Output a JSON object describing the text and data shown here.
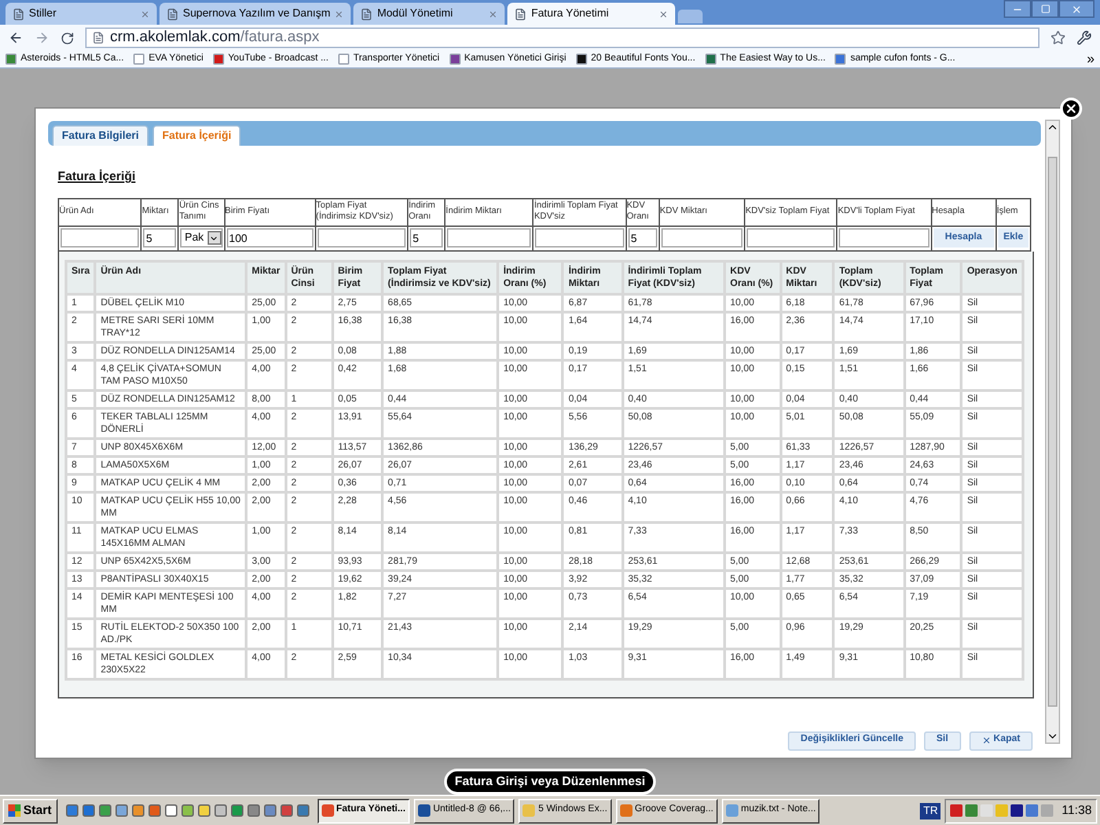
{
  "browser": {
    "tabs": [
      {
        "title": "Stiller",
        "selected": false
      },
      {
        "title": "Supernova Yazılım ve Danışm",
        "selected": false
      },
      {
        "title": "Modül Yönetimi",
        "selected": false
      },
      {
        "title": "Fatura Yönetimi",
        "selected": true
      }
    ],
    "address": {
      "host": "crm.akolemlak.com",
      "path": "/fatura.aspx"
    },
    "bookmarks": [
      {
        "label": "Asteroids - HTML5 Ca...",
        "color": "#3a8a3a"
      },
      {
        "label": "EVA Yönetici",
        "color": "#ffffff"
      },
      {
        "label": "YouTube - Broadcast ...",
        "color": "#d11a1a"
      },
      {
        "label": "Transporter Yönetici",
        "color": "#ffffff"
      },
      {
        "label": "Kamusen Yönetici Girişi",
        "color": "#7a3f9a"
      },
      {
        "label": "20 Beautiful Fonts You...",
        "color": "#111111"
      },
      {
        "label": "The Easiest Way to Us...",
        "color": "#1f6f4a"
      },
      {
        "label": "sample cufon fonts - G...",
        "color": "#3b73d8"
      }
    ],
    "more": "»"
  },
  "modal": {
    "tabs": [
      {
        "label": "Fatura Bilgileri",
        "selected": false
      },
      {
        "label": "Fatura İçeriği",
        "selected": true
      }
    ],
    "section_title": "Fatura İçeriği",
    "entry_form": {
      "columns": [
        "Ürün Adı",
        "Miktarı",
        "Ürün Cins Tanımı",
        "Birim Fiyatı",
        "Toplam Fiyat (İndirimsiz KDV'siz)",
        "İndirim Oranı",
        "İndirim Miktarı",
        "İndirimli Toplam Fiyat KDV'siz",
        "KDV Oranı",
        "KDV Miktarı",
        "KDV'siz Toplam Fiyat",
        "KDV'li Toplam Fiyat",
        "Hesapla",
        "İşlem"
      ],
      "fields": [
        {
          "kind": "input"
        },
        {
          "kind": "input",
          "value": "5"
        },
        {
          "kind": "select",
          "value": "Pak"
        },
        {
          "kind": "input",
          "value": "100"
        },
        {
          "kind": "input"
        },
        {
          "kind": "input",
          "value": "5"
        },
        {
          "kind": "input"
        },
        {
          "kind": "input"
        },
        {
          "kind": "input",
          "value": "5"
        },
        {
          "kind": "input"
        },
        {
          "kind": "input"
        },
        {
          "kind": "input"
        },
        {
          "kind": "button",
          "label": "Hesapla"
        },
        {
          "kind": "button",
          "label": "Ekle"
        }
      ]
    },
    "items_table": {
      "columns": [
        "Sıra",
        "Ürün Adı",
        "Miktar",
        "Ürün Cinsi",
        "Birim Fiyat",
        "Toplam Fiyat (İndirimsiz ve KDV'siz)",
        "İndirim Oranı (%)",
        "İndirim Miktarı",
        "İndirimli Toplam Fiyat (KDV'siz)",
        "KDV Oranı (%)",
        "KDV Miktarı",
        "Toplam (KDV'siz)",
        "Toplam Fiyat",
        "Operasyon"
      ],
      "rows": [
        [
          "1",
          "DÜBEL ÇELİK M10",
          "25,00",
          "2",
          "2,75",
          "68,65",
          "10,00",
          "6,87",
          "61,78",
          "10,00",
          "6,18",
          "61,78",
          "67,96",
          "Sil"
        ],
        [
          "2",
          "METRE SARI SERİ 10MM TRAY*12",
          "1,00",
          "2",
          "16,38",
          "16,38",
          "10,00",
          "1,64",
          "14,74",
          "16,00",
          "2,36",
          "14,74",
          "17,10",
          "Sil"
        ],
        [
          "3",
          "DÜZ RONDELLA DIN125AM14",
          "25,00",
          "2",
          "0,08",
          "1,88",
          "10,00",
          "0,19",
          "1,69",
          "10,00",
          "0,17",
          "1,69",
          "1,86",
          "Sil"
        ],
        [
          "4",
          "4,8 ÇELİK ÇİVATA+SOMUN TAM PASO M10X50",
          "4,00",
          "2",
          "0,42",
          "1,68",
          "10,00",
          "0,17",
          "1,51",
          "10,00",
          "0,15",
          "1,51",
          "1,66",
          "Sil"
        ],
        [
          "5",
          "DÜZ RONDELLA DIN125AM12",
          "8,00",
          "1",
          "0,05",
          "0,44",
          "10,00",
          "0,04",
          "0,40",
          "10,00",
          "0,04",
          "0,40",
          "0,44",
          "Sil"
        ],
        [
          "6",
          "TEKER TABLALI 125MM DÖNERLİ",
          "4,00",
          "2",
          "13,91",
          "55,64",
          "10,00",
          "5,56",
          "50,08",
          "10,00",
          "5,01",
          "50,08",
          "55,09",
          "Sil"
        ],
        [
          "7",
          "UNP 80X45X6X6M",
          "12,00",
          "2",
          "113,57",
          "1362,86",
          "10,00",
          "136,29",
          "1226,57",
          "5,00",
          "61,33",
          "1226,57",
          "1287,90",
          "Sil"
        ],
        [
          "8",
          "LAMA50X5X6M",
          "1,00",
          "2",
          "26,07",
          "26,07",
          "10,00",
          "2,61",
          "23,46",
          "5,00",
          "1,17",
          "23,46",
          "24,63",
          "Sil"
        ],
        [
          "9",
          "MATKAP UCU ÇELİK 4 MM",
          "2,00",
          "2",
          "0,36",
          "0,71",
          "10,00",
          "0,07",
          "0,64",
          "16,00",
          "0,10",
          "0,64",
          "0,74",
          "Sil"
        ],
        [
          "10",
          "MATKAP UCU ÇELİK H55 10,00 MM",
          "2,00",
          "2",
          "2,28",
          "4,56",
          "10,00",
          "0,46",
          "4,10",
          "16,00",
          "0,66",
          "4,10",
          "4,76",
          "Sil"
        ],
        [
          "11",
          "MATKAP UCU ELMAS 145X16MM ALMAN",
          "1,00",
          "2",
          "8,14",
          "8,14",
          "10,00",
          "0,81",
          "7,33",
          "16,00",
          "1,17",
          "7,33",
          "8,50",
          "Sil"
        ],
        [
          "12",
          "UNP 65X42X5,5X6M",
          "3,00",
          "2",
          "93,93",
          "281,79",
          "10,00",
          "28,18",
          "253,61",
          "5,00",
          "12,68",
          "253,61",
          "266,29",
          "Sil"
        ],
        [
          "13",
          "P8ANTİPASLI 30X40X15",
          "2,00",
          "2",
          "19,62",
          "39,24",
          "10,00",
          "3,92",
          "35,32",
          "5,00",
          "1,77",
          "35,32",
          "37,09",
          "Sil"
        ],
        [
          "14",
          "DEMİR KAPI MENTEŞESİ 100 MM",
          "4,00",
          "2",
          "1,82",
          "7,27",
          "10,00",
          "0,73",
          "6,54",
          "10,00",
          "0,65",
          "6,54",
          "7,19",
          "Sil"
        ],
        [
          "15",
          "RUTİL ELEKTOD-2 50X350 100 AD./PK",
          "2,00",
          "1",
          "10,71",
          "21,43",
          "10,00",
          "2,14",
          "19,29",
          "5,00",
          "0,96",
          "19,29",
          "20,25",
          "Sil"
        ],
        [
          "16",
          "METAL KESİCİ GOLDLEX 230X5X22",
          "4,00",
          "2",
          "2,59",
          "10,34",
          "10,00",
          "1,03",
          "9,31",
          "16,00",
          "1,49",
          "9,31",
          "10,80",
          "Sil"
        ]
      ]
    },
    "buttons": [
      {
        "label": "Değişiklikleri Güncelle",
        "kind": "plain"
      },
      {
        "label": "Sil",
        "kind": "plain"
      },
      {
        "label": "Kapat",
        "kind": "close"
      }
    ]
  },
  "caption": "Fatura Girişi veya Düzenlenmesi",
  "taskbar": {
    "start": "Start",
    "tasks": [
      {
        "label": "Fatura Yöneti...",
        "selected": true,
        "color": "#e04a2a"
      },
      {
        "label": "Untitled-8 @ 66,...",
        "selected": false,
        "color": "#1b4f9a"
      },
      {
        "label": "5 Windows Ex...",
        "selected": false,
        "color": "#e8c04a"
      },
      {
        "label": "Groove Coverag...",
        "selected": false,
        "color": "#e0701a"
      },
      {
        "label": "muzik.txt - Note...",
        "selected": false,
        "color": "#6aa0d8"
      }
    ],
    "language": "TR",
    "time": "11:38"
  }
}
